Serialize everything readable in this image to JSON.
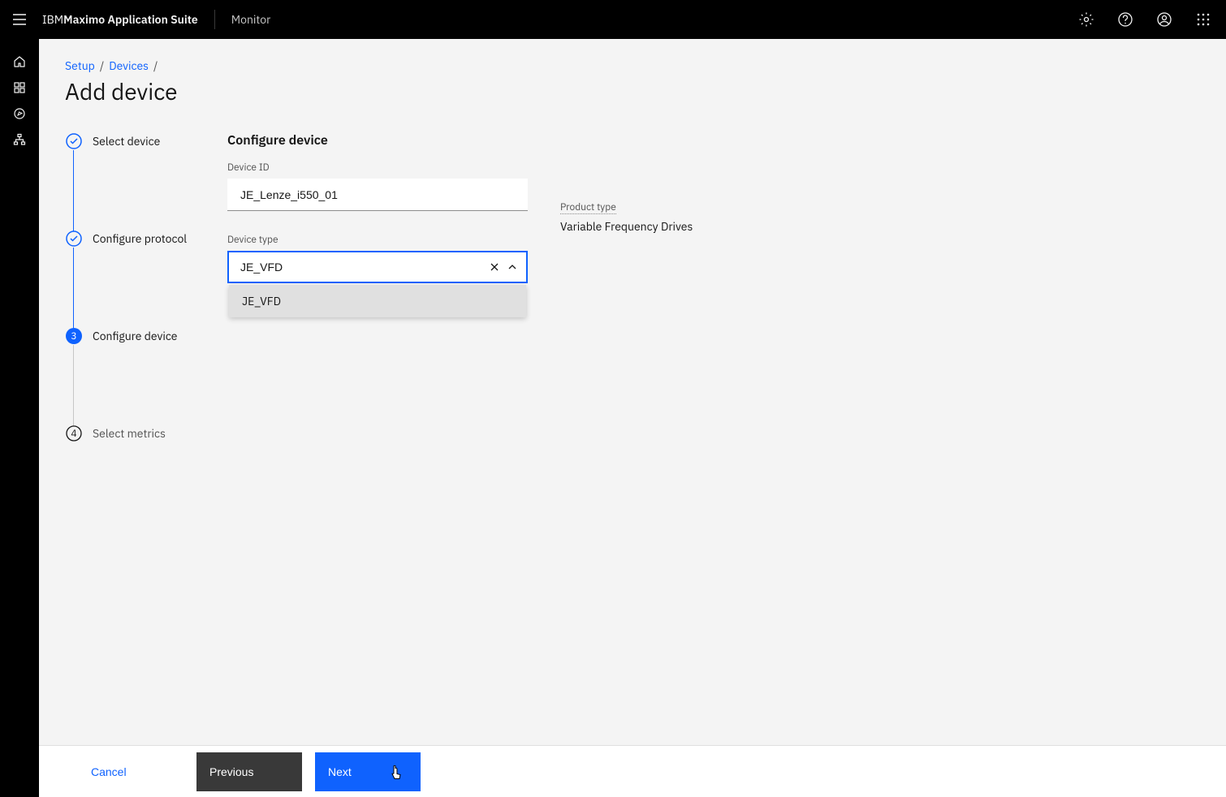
{
  "header": {
    "brand_prefix": "IBM ",
    "brand_bold": "Maximo Application Suite",
    "app": "Monitor"
  },
  "breadcrumb": {
    "item1": "Setup",
    "item2": "Devices"
  },
  "page": {
    "title": "Add device"
  },
  "stepper": {
    "step1": "Select device",
    "step2": "Configure protocol",
    "step3": "Configure device",
    "step4": "Select metrics",
    "step3_num": "3",
    "step4_num": "4"
  },
  "form": {
    "section_title": "Configure device",
    "device_id_label": "Device ID",
    "device_id_value": "JE_Lenze_i550_01",
    "device_type_label": "Device type",
    "device_type_value": "JE_VFD",
    "dropdown_option_1": "JE_VFD",
    "product_type_label": "Product type",
    "product_type_value": "Variable Frequency Drives"
  },
  "buttons": {
    "cancel": "Cancel",
    "previous": "Previous",
    "next": "Next"
  }
}
